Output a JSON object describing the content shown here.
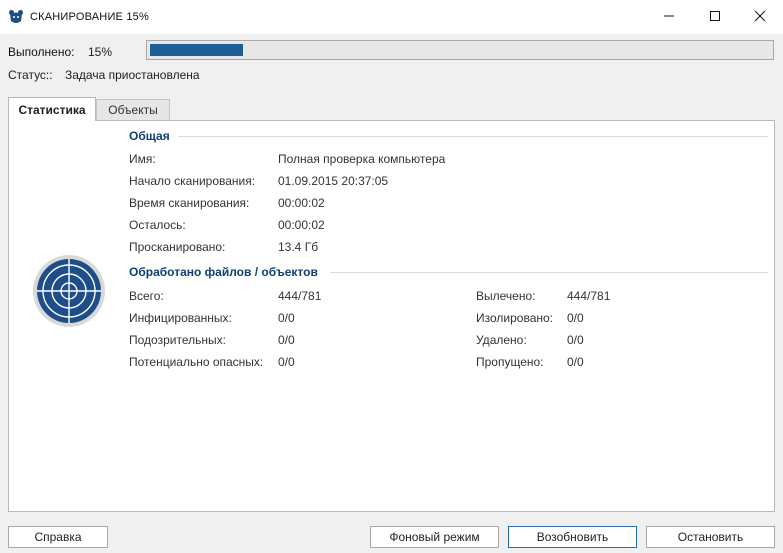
{
  "window": {
    "title": "СКАНИРОВАНИЕ 15%",
    "min_icon": "minimize-icon",
    "max_icon": "maximize-icon",
    "close_icon": "close-icon"
  },
  "progress": {
    "label": "Выполнено:",
    "value_text": "15%",
    "fraction": 0.15,
    "color": "#1e5f96"
  },
  "status": {
    "label": "Статус::",
    "value": "Задача приостановлена"
  },
  "tabs": [
    {
      "label": "Статистика",
      "selected": true
    },
    {
      "label": "Объекты",
      "selected": false
    }
  ],
  "general": {
    "title": "Общая",
    "rows": [
      {
        "key": "Имя:",
        "value": "Полная проверка компьютера"
      },
      {
        "key": "Начало сканирования:",
        "value": "01.09.2015 20:37:05"
      },
      {
        "key": "Время сканирования:",
        "value": "00:00:02"
      },
      {
        "key": "Осталось:",
        "value": "00:00:02"
      },
      {
        "key": "Просканировано:",
        "value": "13.4 Гб"
      }
    ]
  },
  "processed": {
    "title": "Обработано файлов / объектов",
    "left": [
      {
        "key": "Всего:",
        "value": "444/781"
      },
      {
        "key": "Инфицированных:",
        "value": "0/0"
      },
      {
        "key": "Подозрительных:",
        "value": "0/0"
      },
      {
        "key": "Потенциально опасных:",
        "value": "0/0"
      }
    ],
    "right": [
      {
        "key": "Вылечено:",
        "value": "444/781"
      },
      {
        "key": "Изолировано:",
        "value": "0/0"
      },
      {
        "key": "Удалено:",
        "value": "0/0"
      },
      {
        "key": "Пропущено:",
        "value": "0/0"
      }
    ]
  },
  "icons": {
    "app": "bear-icon",
    "radar": "radar-target-icon"
  },
  "buttons": {
    "help": "Справка",
    "background": "Фоновый режим",
    "resume": "Возобновить",
    "stop": "Остановить"
  }
}
